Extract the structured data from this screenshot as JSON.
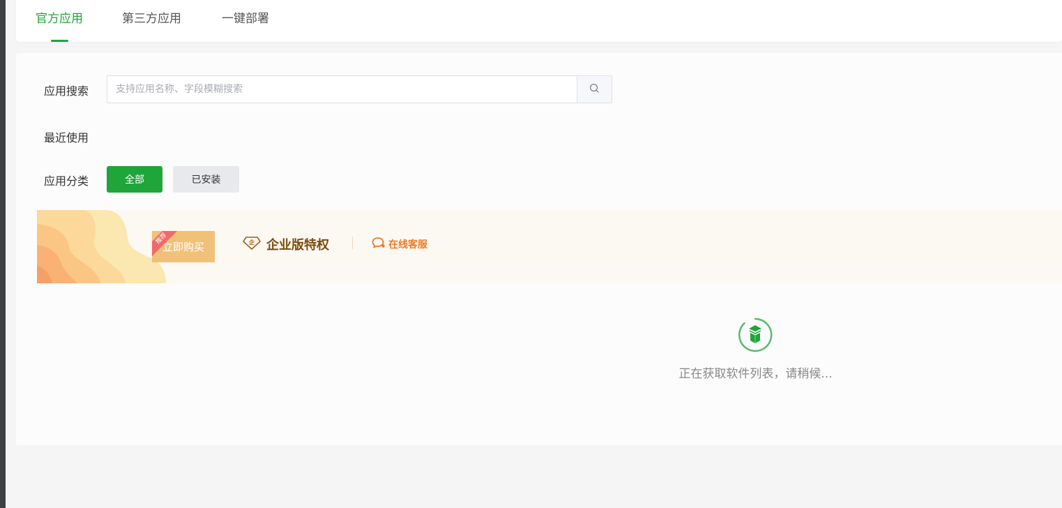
{
  "tabs": [
    {
      "label": "官方应用",
      "active": true
    },
    {
      "label": "第三方应用",
      "active": false
    },
    {
      "label": "一键部署",
      "active": false
    }
  ],
  "search": {
    "label": "应用搜索",
    "placeholder": "支持应用名称、字段模糊搜索",
    "value": ""
  },
  "recent": {
    "label": "最近使用"
  },
  "category": {
    "label": "应用分类",
    "buttons": [
      {
        "label": "全部",
        "active": true
      },
      {
        "label": "已安装",
        "active": false
      }
    ]
  },
  "banner": {
    "ribbon": "推荐",
    "buy_label": "立即购买",
    "enterprise_label": "企业版特权",
    "enterprise_icon_glyph": "企",
    "service_label": "在线客服"
  },
  "loading": {
    "text": "正在获取软件列表，请稍候..."
  },
  "colors": {
    "accent": "#20a53a",
    "banner_bg": "#fcf8f2",
    "buy_button": "#f1c17a",
    "ribbon": "#f06a6a",
    "enterprise_text": "#7a4d10",
    "service_text": "#ee7a26"
  }
}
